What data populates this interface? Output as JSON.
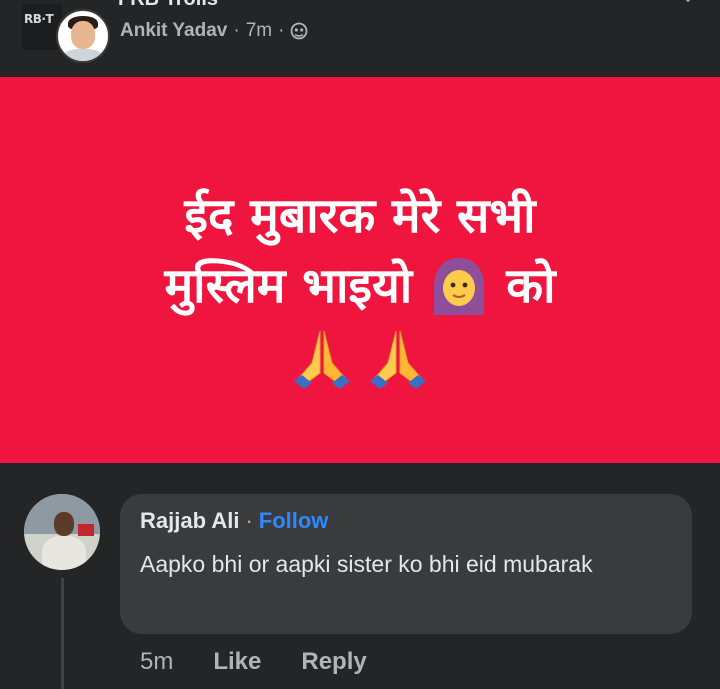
{
  "header": {
    "group_badge": "RB·T",
    "group_title": "FRB Trolls",
    "author": "Ankit Yadav",
    "time": "7m",
    "separator": "·"
  },
  "post": {
    "background_color": "#f0153f",
    "line1": "ईद मुबारक मेरे सभी",
    "line2_left": "मुस्लिम भाइयो",
    "line2_right": "को",
    "emoji_icons": [
      "woman-with-headscarf-icon",
      "folded-hands-icon",
      "folded-hands-icon"
    ]
  },
  "comment": {
    "author": "Rajjab Ali",
    "separator": "·",
    "follow_label": "Follow",
    "text": "Aapko bhi or aapki sister ko bhi eid mubarak",
    "time": "5m",
    "like_label": "Like",
    "reply_label": "Reply"
  },
  "colors": {
    "background": "#242526",
    "bubble": "#3a3b3c",
    "link": "#2e89ff",
    "secondary_text": "#b0b3b8"
  }
}
